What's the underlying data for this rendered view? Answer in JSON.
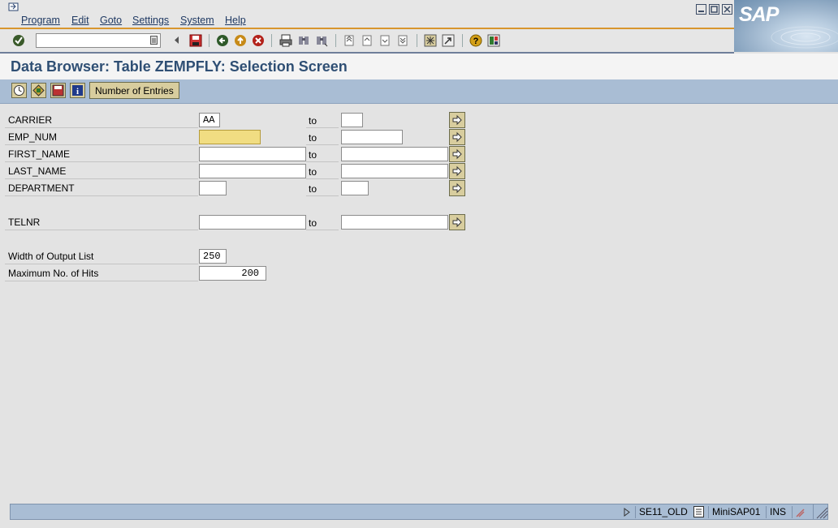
{
  "menu": {
    "items": [
      "Program",
      "Edit",
      "Goto",
      "Settings",
      "System",
      "Help"
    ]
  },
  "logo": {
    "text": "SAP"
  },
  "command_field": {
    "value": ""
  },
  "title": "Data Browser: Table ZEMPFLY: Selection Screen",
  "app_toolbar": {
    "number_of_entries_label": "Number of Entries"
  },
  "fields": [
    {
      "label": "CARRIER",
      "low": "AA",
      "to": "to",
      "high": ""
    },
    {
      "label": "EMP_NUM",
      "low": "",
      "to": "to",
      "high": ""
    },
    {
      "label": "FIRST_NAME",
      "low": "",
      "to": "to",
      "high": ""
    },
    {
      "label": "LAST_NAME",
      "low": "",
      "to": "to",
      "high": ""
    },
    {
      "label": "DEPARTMENT",
      "low": "",
      "to": "to",
      "high": ""
    },
    {
      "label": "TELNR",
      "low": "",
      "to": "to",
      "high": ""
    }
  ],
  "settings": {
    "width_label": "Width of Output List",
    "width_value": "250",
    "maxhits_label": "Maximum No. of Hits",
    "maxhits_value": "200"
  },
  "status_bar": {
    "transaction": "SE11_OLD",
    "system": "MiniSAP01",
    "mode": "INS"
  },
  "colors": {
    "accent_blue": "#a9bdd4",
    "title_text": "#2f4f74",
    "required_field": "#f1dd82",
    "button_face": "#d8cd9e",
    "orange_line": "#d8962e"
  }
}
